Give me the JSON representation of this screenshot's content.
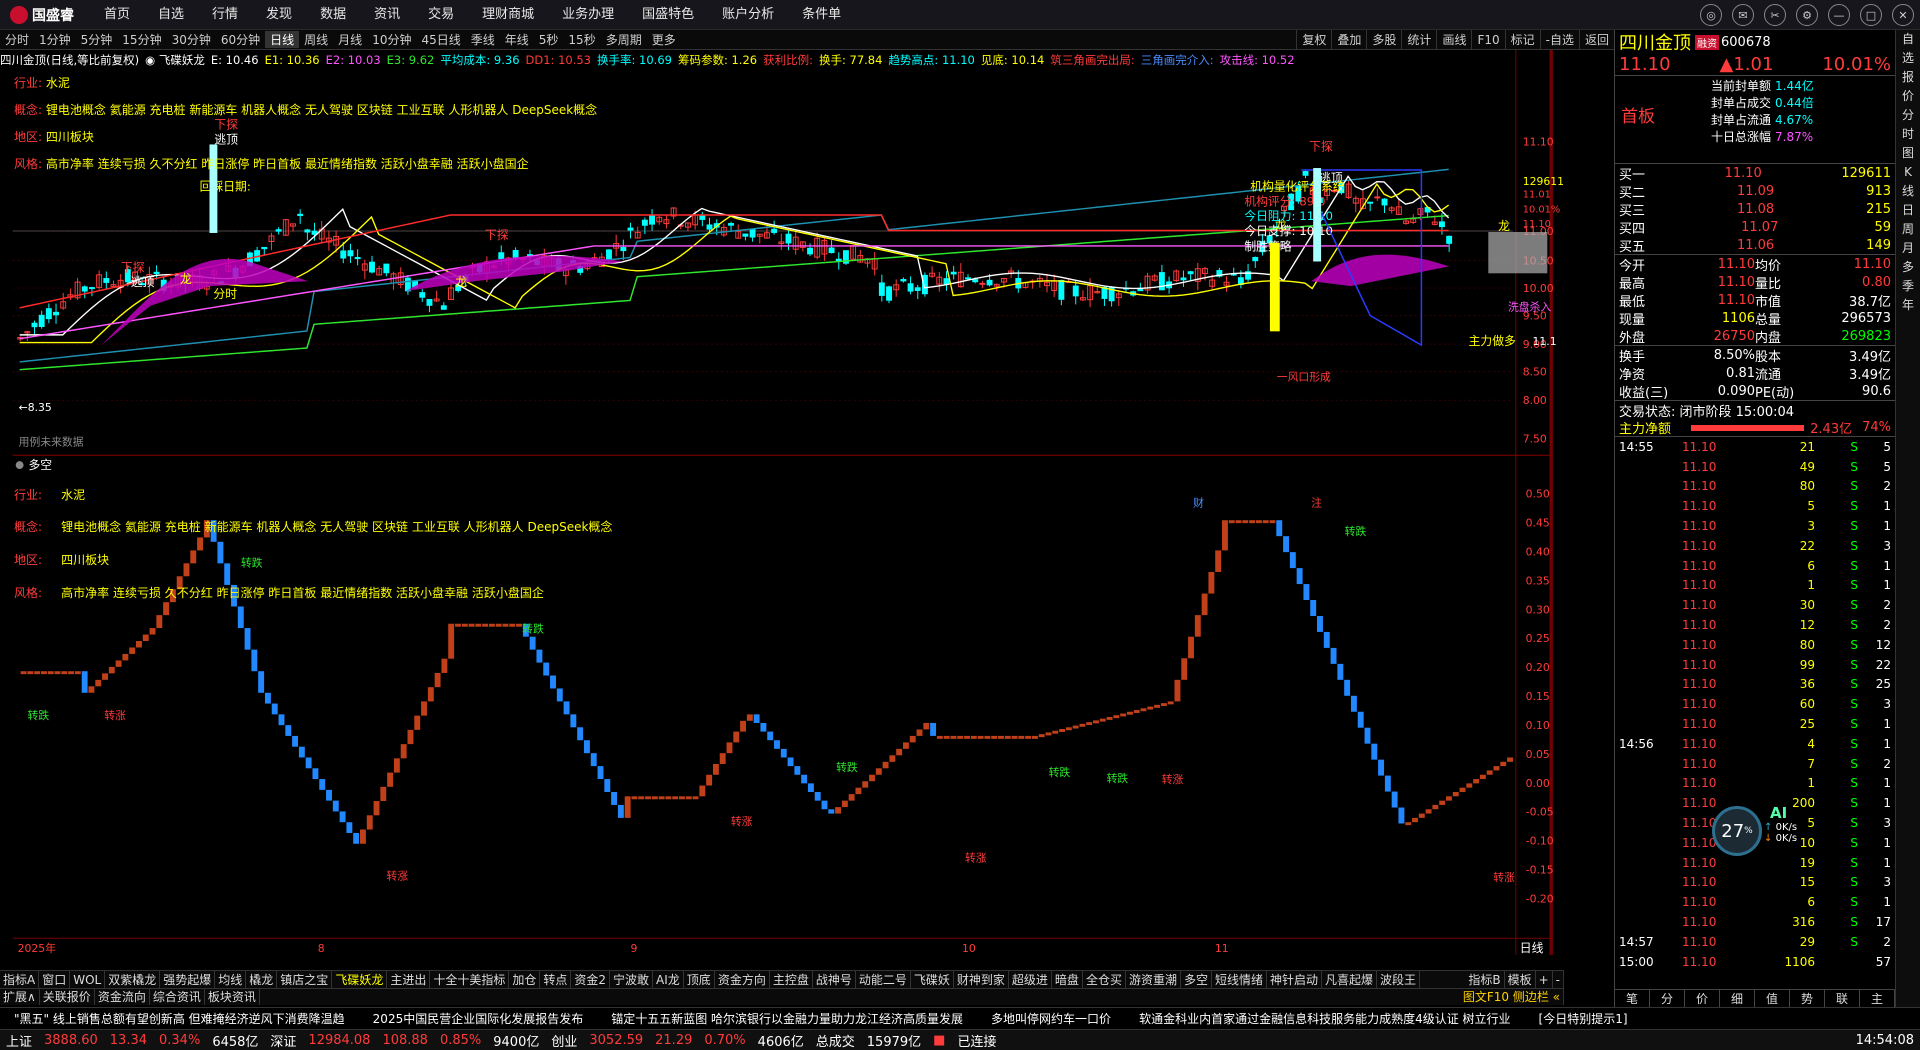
{
  "menubar": {
    "brand": "国盛睿",
    "items": [
      "首页",
      "自选",
      "行情",
      "发现",
      "数据",
      "资讯",
      "交易",
      "理财商城",
      "业务办理",
      "国盛特色",
      "账户分析",
      "条件单"
    ]
  },
  "periods": [
    "分时",
    "1分钟",
    "5分钟",
    "15分钟",
    "30分钟",
    "60分钟",
    "日线",
    "周线",
    "月线",
    "10分钟",
    "45日线",
    "季线",
    "年线",
    "5秒",
    "15秒",
    "多周期",
    "更多"
  ],
  "ptools": [
    "复权",
    "叠加",
    "多股",
    "统计",
    "画线",
    "F10",
    "标记",
    "-自选",
    "返回"
  ],
  "title": {
    "name": "四川金顶(日线,等比前复权)",
    "plugin": "飞碟妖龙",
    "E": "E: 10.46",
    "E1": "E1: 10.36",
    "E2": "E2: 10.03",
    "E3": "E3: 9.62",
    "avgcost": "平均成本: 9.36",
    "dd1": "DD1: 10.53",
    "turn": "换手率: 10.69",
    "chip": "筹码参数: 1.26",
    "profit": "获利比例:",
    "hs": "换手: 77.84",
    "trend": "趋势高点: 11.10",
    "xian": "见底: 10.14",
    "tri": "筑三角画完出局:",
    "tri2": "三角画完介入:",
    "attack": "攻击线: 10.52"
  },
  "info": {
    "industry_lab": "行业:",
    "industry": "水泥",
    "concept_lab": "概念:",
    "concept": "锂电池概念 氦能源 充电桩 新能源车 机器人概念 无人驾驶 区块链 工业互联 人形机器人 DeepSeek概念",
    "region_lab": "地区:",
    "region": "四川板块",
    "style_lab": "风格:",
    "style": "高市净率 连续亏损 久不分红 昨日涨停 昨日首板 最近情绪指数 活跃小盘幸融 活跃小盘国企"
  },
  "annot": {
    "xiecha": "下探",
    "jianmai": "逃顶",
    "long": "龙",
    "huiluo": "回踩日期:",
    "fenfa": "分时",
    "liangcha": "机构量化评分系统",
    "jgpf": "机构评分: 89.0",
    "zlx": "今日阻力: 11.10",
    "zc": "今日支撑: 10.10",
    "zhishou": "制胜策略",
    "xipan": "洗盘杀入",
    "zljx": "主力做多",
    "yuanri": "一风口形成",
    "zhu": "注",
    "cai": "财",
    "pending": "用例未来数据",
    "low": "←8.35",
    "high_price": "11.1"
  },
  "yaxis_main": [
    "11.10",
    "129611",
    "11.00",
    "10.50",
    "10.00",
    "9.50",
    "9.00",
    "8.50",
    "8.00",
    "7.50"
  ],
  "yaxis_main_extra": [
    "11.01",
    "10.01%",
    "11.10"
  ],
  "yaxis_sub": [
    "0.50",
    "0.45",
    "0.40",
    "0.35",
    "0.30",
    "0.25",
    "0.20",
    "0.15",
    "0.10",
    "0.05",
    "0.00",
    "-0.05",
    "-0.10",
    "-0.15",
    "-0.20"
  ],
  "subtitle": "多空",
  "sub_labels": {
    "zhuan_zhang": "转涨",
    "zhuan_die": "转跌"
  },
  "xaxis": [
    "2025年",
    "8",
    "9",
    "10",
    "11"
  ],
  "xaxis_right": "日线",
  "toolbar2": [
    "指标A",
    "窗口",
    "WOL",
    "双紫橇龙",
    "强势起爆",
    "均线",
    "橇龙",
    "镇店之宝",
    "飞碟妖龙",
    "主进出",
    "十全十美指标",
    "加仓",
    "转点",
    "资金2",
    "宁波敢",
    "AI龙",
    "顶底",
    "资金方向",
    "主控盘",
    "战神号",
    "动能二号",
    "飞碟妖",
    "财神到家",
    "超级进",
    "暗盘",
    "全仓买",
    "游资重潮",
    "多空",
    "短线情绪",
    "神针启动",
    "凡喜起爆",
    "波段王"
  ],
  "toolbar2_right": [
    "指标B",
    "模板",
    "+",
    "-"
  ],
  "toolbar3": [
    "扩展∧",
    "关联报价",
    "资金流向",
    "综合资讯",
    "板块资讯"
  ],
  "toolbar3_right": "图文F10 侧边栏 «",
  "news": [
    "\"黑五\" 线上销售总额有望创新高 但难掩经济逆风下消费降温趋",
    "2025中国民营企业国际化发展报告发布",
    "锚定十五五新蓝图 哈尔滨银行以金融力量助力龙江经济高质量发展",
    "多地叫停网约车一口价",
    "软通金科业内首家通过金融信息科技服务能力成熟度4级认证 树立行业",
    "[今日特别提示1]"
  ],
  "status": {
    "sh": "上证",
    "sh_v": "3888.60",
    "sh_c": "13.34",
    "sh_p": "0.34%",
    "sh_a": "6458亿",
    "sz": "深证",
    "sz_v": "12984.08",
    "sz_c": "108.88",
    "sz_p": "0.85%",
    "sz_a": "9400亿",
    "cy": "创业",
    "cy_v": "3052.59",
    "cy_c": "21.29",
    "cy_p": "0.70%",
    "cy_a": "4606亿",
    "total": "总成交",
    "total_v": "15979亿",
    "conn": "已连接",
    "time": "14:54:08"
  },
  "rp": {
    "name": "四川金顶",
    "code": "600678",
    "tag": "融资",
    "price": "11.10",
    "chg": "▲1.01",
    "pct": "10.01%",
    "board": "首板",
    "seal": [
      [
        "当前封单额",
        "1.44亿"
      ],
      [
        "封单占成交",
        "0.44倍"
      ],
      [
        "封单占流通",
        "4.67%"
      ],
      [
        "十日总涨幅",
        "7.87%"
      ]
    ],
    "buys": [
      [
        "买一",
        "11.10",
        "129611"
      ],
      [
        "买二",
        "11.09",
        "913"
      ],
      [
        "买三",
        "11.08",
        "215"
      ],
      [
        "买四",
        "11.07",
        "59"
      ],
      [
        "买五",
        "11.06",
        "149"
      ]
    ],
    "stats": [
      [
        "今开",
        "11.10",
        "均价",
        "11.10"
      ],
      [
        "最高",
        "11.10",
        "量比",
        "0.80"
      ],
      [
        "最低",
        "11.10",
        "市值",
        "38.7亿"
      ],
      [
        "现量",
        "1106",
        "总量",
        "296573"
      ],
      [
        "外盘",
        "26750",
        "内盘",
        "269823"
      ]
    ],
    "fin": [
      [
        "换手",
        "8.50%",
        "股本",
        "3.49亿"
      ],
      [
        "净资",
        "0.81",
        "流通",
        "3.49亿"
      ],
      [
        "收益(三)",
        "0.090",
        "PE(动)",
        "90.6"
      ]
    ],
    "trade_state": "交易状态: 闭市阶段 15:00:04",
    "mainflow_lab": "主力净额",
    "mainflow": "2.43亿",
    "mainflow_pct": "74%",
    "ticks": [
      [
        "14:55",
        "11.10",
        "21",
        "S",
        "5"
      ],
      [
        "",
        "11.10",
        "49",
        "S",
        "5"
      ],
      [
        "",
        "11.10",
        "80",
        "S",
        "2"
      ],
      [
        "",
        "11.10",
        "5",
        "S",
        "1"
      ],
      [
        "",
        "11.10",
        "3",
        "S",
        "1"
      ],
      [
        "",
        "11.10",
        "22",
        "S",
        "3"
      ],
      [
        "",
        "11.10",
        "6",
        "S",
        "1"
      ],
      [
        "",
        "11.10",
        "1",
        "S",
        "1"
      ],
      [
        "",
        "11.10",
        "30",
        "S",
        "2"
      ],
      [
        "",
        "11.10",
        "12",
        "S",
        "2"
      ],
      [
        "",
        "11.10",
        "80",
        "S",
        "12"
      ],
      [
        "",
        "11.10",
        "99",
        "S",
        "22"
      ],
      [
        "",
        "11.10",
        "36",
        "S",
        "25"
      ],
      [
        "",
        "11.10",
        "60",
        "S",
        "3"
      ],
      [
        "",
        "11.10",
        "25",
        "S",
        "1"
      ],
      [
        "14:56",
        "11.10",
        "4",
        "S",
        "1"
      ],
      [
        "",
        "11.10",
        "7",
        "S",
        "2"
      ],
      [
        "",
        "11.10",
        "1",
        "S",
        "1"
      ],
      [
        "",
        "11.10",
        "200",
        "S",
        "1"
      ],
      [
        "",
        "11.10",
        "5",
        "S",
        "3"
      ],
      [
        "",
        "11.10",
        "10",
        "S",
        "1"
      ],
      [
        "",
        "11.10",
        "19",
        "S",
        "1"
      ],
      [
        "",
        "11.10",
        "15",
        "S",
        "3"
      ],
      [
        "",
        "11.10",
        "6",
        "S",
        "1"
      ],
      [
        "",
        "11.10",
        "316",
        "S",
        "17"
      ],
      [
        "14:57",
        "11.10",
        "29",
        "S",
        "2"
      ],
      [
        "15:00",
        "11.10",
        "1106",
        "",
        "57"
      ]
    ],
    "cpu": "27",
    "cpu_unit": "%",
    "net_up": "0K/s",
    "net_dn": "0K/s",
    "ai": "AI",
    "bottom_tabs": [
      "笔",
      "分",
      "价",
      "细",
      "值",
      "势",
      "联",
      "主"
    ]
  },
  "sidebar": [
    "自",
    "选",
    "报",
    "价",
    "分",
    "时",
    "图",
    "K",
    "线",
    "日",
    "周",
    "月",
    "多",
    "季",
    "年"
  ],
  "colors": {
    "up": "#ff3b3b",
    "down": "#00ffff",
    "accent": "#ffff00"
  }
}
